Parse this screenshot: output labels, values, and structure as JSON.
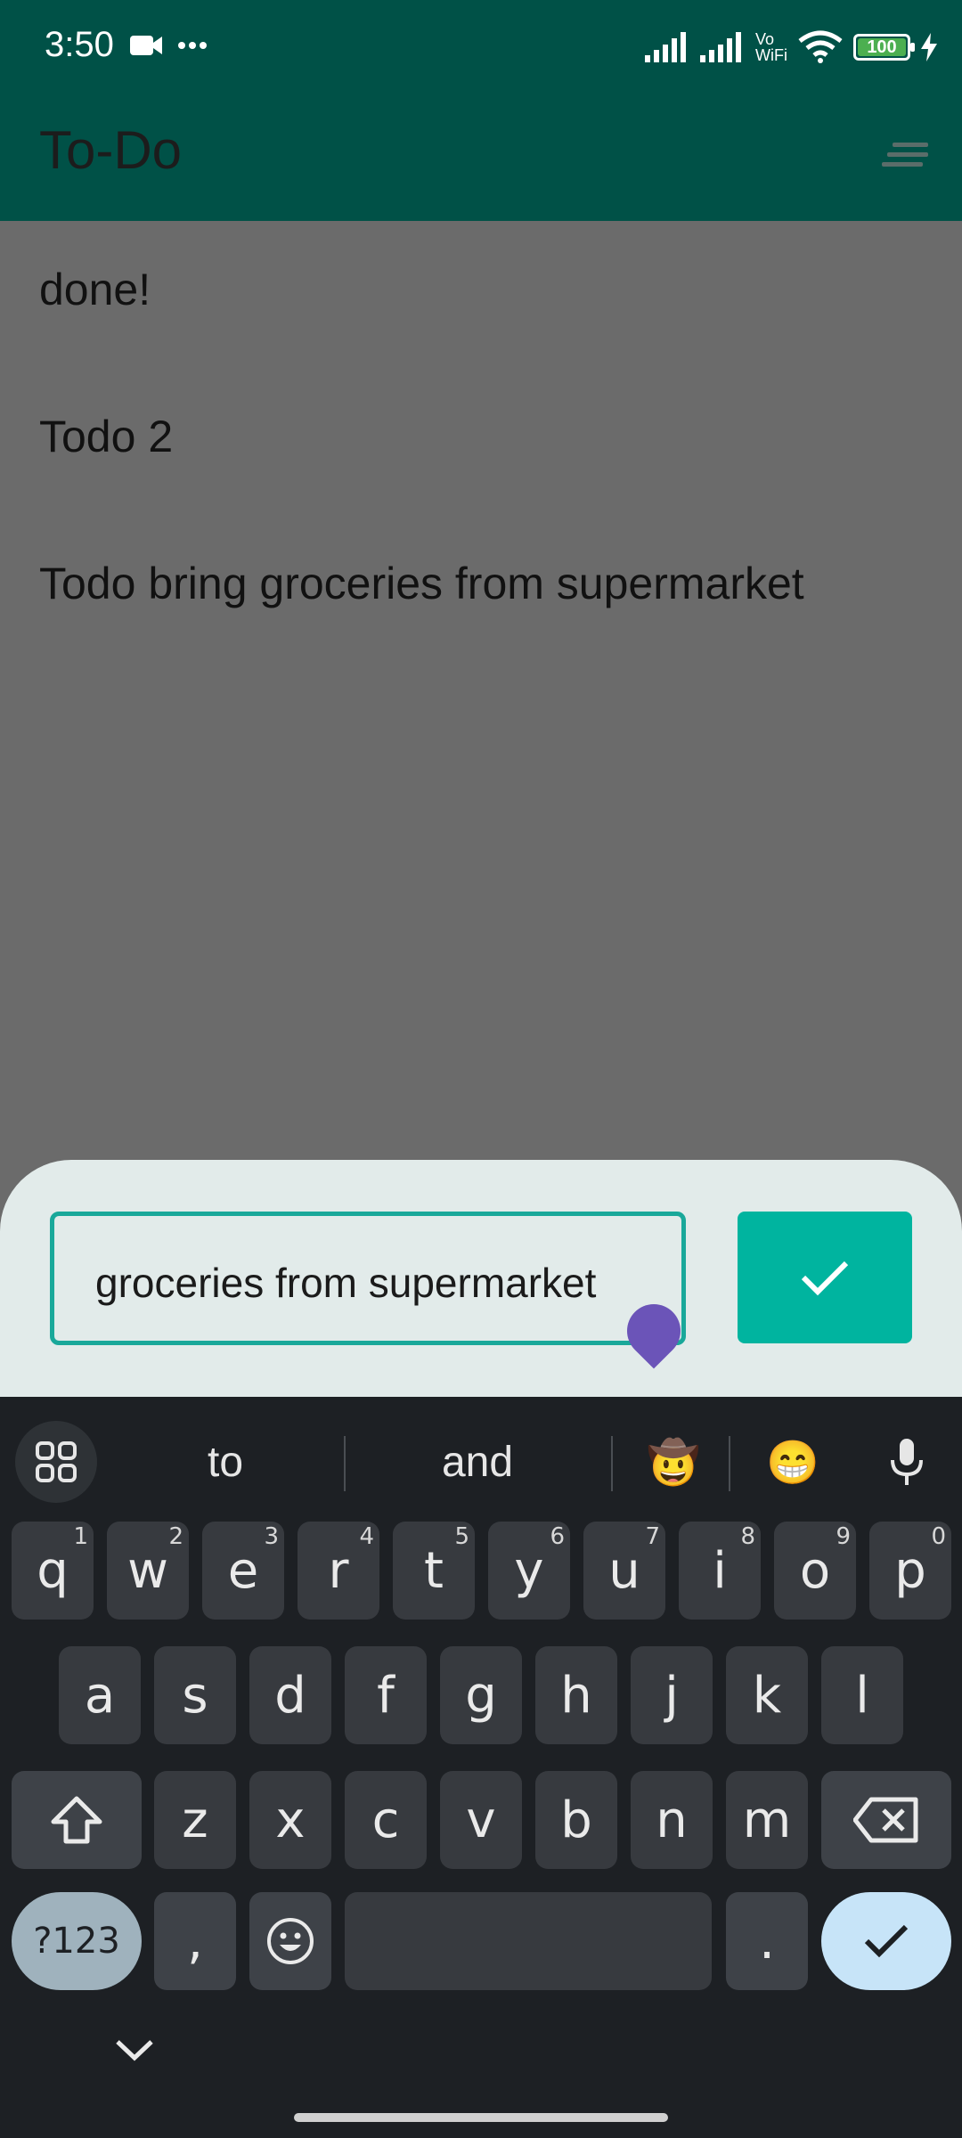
{
  "status": {
    "time": "3:50",
    "vowifi": "Vo\nWiFi",
    "battery": "100"
  },
  "app": {
    "title": "To-Do"
  },
  "todos": [
    "done!",
    "Todo 2",
    "Todo bring groceries from supermarket"
  ],
  "input": {
    "value": "groceries from supermarket"
  },
  "suggestions": [
    "to",
    "and",
    "🤠",
    "😁"
  ],
  "keyboard": {
    "row1": [
      {
        "k": "q",
        "h": "1"
      },
      {
        "k": "w",
        "h": "2"
      },
      {
        "k": "e",
        "h": "3"
      },
      {
        "k": "r",
        "h": "4"
      },
      {
        "k": "t",
        "h": "5"
      },
      {
        "k": "y",
        "h": "6"
      },
      {
        "k": "u",
        "h": "7"
      },
      {
        "k": "i",
        "h": "8"
      },
      {
        "k": "o",
        "h": "9"
      },
      {
        "k": "p",
        "h": "0"
      }
    ],
    "row2": [
      "a",
      "s",
      "d",
      "f",
      "g",
      "h",
      "j",
      "k",
      "l"
    ],
    "row3": [
      "z",
      "x",
      "c",
      "v",
      "b",
      "n",
      "m"
    ],
    "sym_label": "?123",
    "comma": ",",
    "period": "."
  },
  "colors": {
    "appbar": "#005147",
    "accent": "#00b49f",
    "handle": "#6b54b8"
  }
}
